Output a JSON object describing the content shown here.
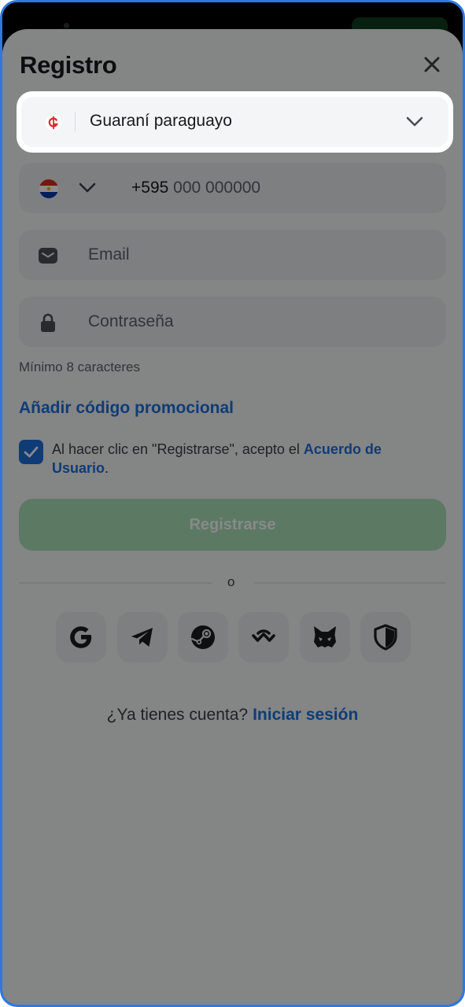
{
  "header": {
    "title": "Registro"
  },
  "currency": {
    "label": "Guaraní paraguayo",
    "symbol": "₲"
  },
  "phone": {
    "prefix": "+595",
    "placeholder": "000 000000"
  },
  "email": {
    "placeholder": "Email"
  },
  "password": {
    "placeholder": "Contraseña",
    "hint": "Mínimo 8 caracteres"
  },
  "promo": {
    "label": "Añadir código promocional"
  },
  "terms": {
    "text": "Al hacer clic en \"Registrarse\", acepto el ",
    "link": "Acuerdo de Usuario",
    "end": ".",
    "checked": true
  },
  "register": {
    "label": "Registrarse"
  },
  "divider": {
    "label": "o"
  },
  "social": [
    "google-icon",
    "telegram-icon",
    "steam-icon",
    "walletconnect-icon",
    "metamask-icon",
    "shield-icon"
  ],
  "footer": {
    "question": "¿Ya tienes cuenta?",
    "link": "Iniciar sesión"
  },
  "colors": {
    "accent": "#1c6fdc",
    "register_button": "#abe0b8",
    "frame_border": "#2a7ae4",
    "currency_symbol": "#e0262d"
  }
}
